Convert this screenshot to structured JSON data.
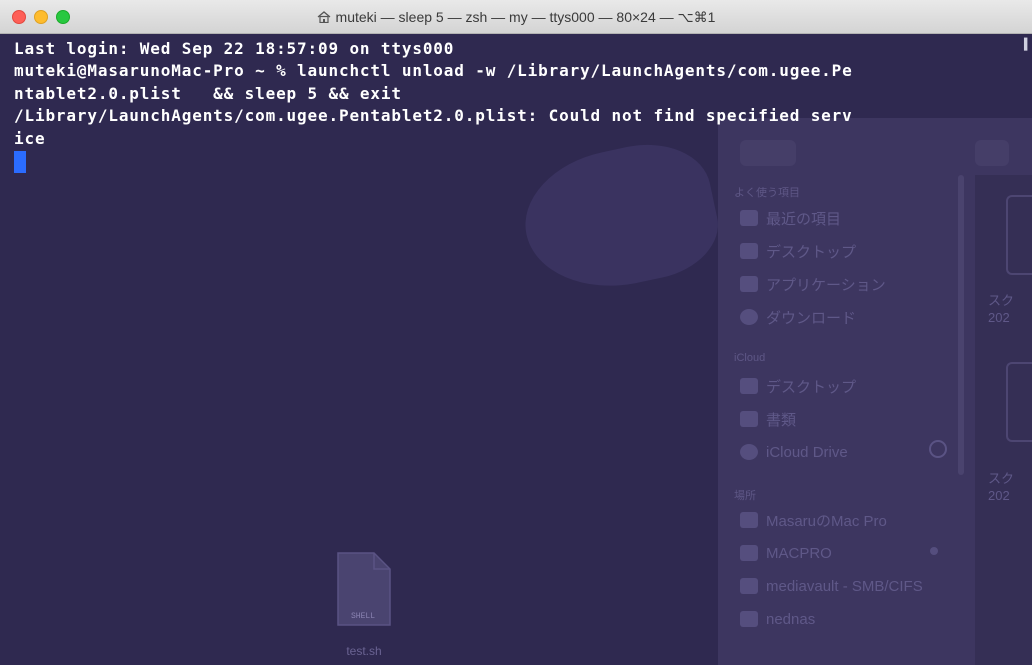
{
  "window": {
    "title": "muteki — sleep 5 — zsh — my — ttys000 — 80×24 — ⌥⌘1"
  },
  "terminal": {
    "lines": [
      "Last login: Wed Sep 22 18:57:09 on ttys000",
      "muteki@MasarunoMac-Pro ~ % launchctl unload -w /Library/LaunchAgents/com.ugee.Pe",
      "ntablet2.0.plist   && sleep 5 && exit",
      "/Library/LaunchAgents/com.ugee.Pentablet2.0.plist: Could not find specified serv",
      "ice"
    ],
    "cursor_color": "#2b6cff",
    "text_color": "#ffffff",
    "background_color": "#2f2950"
  },
  "background": {
    "finder_sidebar": {
      "section_favorites": "よく使う項目",
      "favorites": [
        "最近の項目",
        "デスクトップ",
        "アプリケーション",
        "ダウンロード"
      ],
      "section_icloud": "iCloud",
      "icloud": [
        "デスクトップ",
        "書類",
        "iCloud Drive"
      ],
      "section_locations": "場所",
      "locations": [
        "MasaruのMac Pro",
        "MACPRO",
        "mediavault - SMB/CIFS",
        "nednas"
      ],
      "side_text_1": [
        "スク",
        "202"
      ],
      "side_text_2": [
        "スク",
        "202"
      ]
    },
    "desktop_file": {
      "name": "test.sh",
      "tag": "SHELL"
    }
  }
}
